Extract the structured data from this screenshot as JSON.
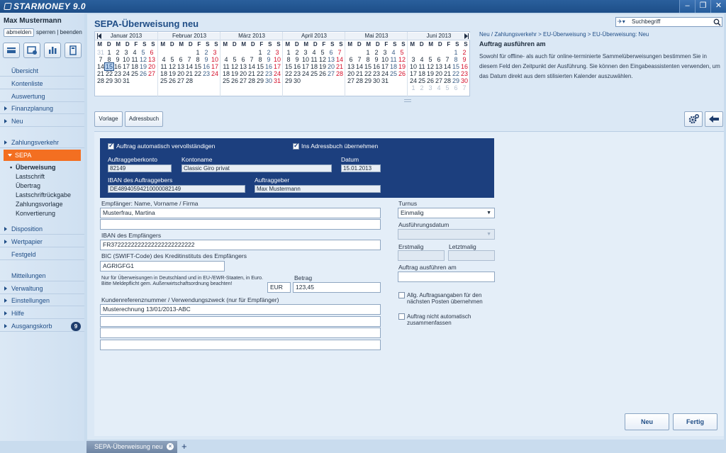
{
  "app": {
    "name": "STARMONEY 9.0",
    "window_buttons": [
      "–",
      "❐",
      "✕"
    ]
  },
  "sidebar": {
    "user": "Max Mustermann",
    "logout": "abmelden",
    "lock_logout": "sperren | beenden",
    "items": [
      {
        "label": "Übersicht"
      },
      {
        "label": "Kontenliste"
      },
      {
        "label": "Auswertung"
      },
      {
        "label": "Finanzplanung"
      },
      {
        "label": "Neu"
      },
      {
        "label": "Zahlungsverkehr"
      },
      {
        "label": "SEPA"
      },
      {
        "label": "Disposition"
      },
      {
        "label": "Wertpapier"
      },
      {
        "label": "Festgeld"
      },
      {
        "label": "Mitteilungen"
      },
      {
        "label": "Verwaltung"
      },
      {
        "label": "Einstellungen"
      },
      {
        "label": "Hilfe"
      },
      {
        "label": "Ausgangskorb"
      }
    ],
    "sepa_sub": [
      "Überweisung",
      "Lastschrift",
      "Übertrag",
      "Lastschriftrückgabe",
      "Zahlungsvorlage",
      "Konvertierung"
    ],
    "outbox_count": "9"
  },
  "header": {
    "title": "SEPA-Überweisung neu",
    "search_placeholder": "Suchbegriff"
  },
  "calendar": {
    "weekdays": [
      "M",
      "D",
      "M",
      "D",
      "F",
      "S",
      "S"
    ],
    "months": [
      {
        "name": "Januar 2013",
        "weeks": [
          [
            "31",
            "1",
            "2",
            "3",
            "4",
            "5",
            "6"
          ],
          [
            "7",
            "8",
            "9",
            "10",
            "11",
            "12",
            "13"
          ],
          [
            "14",
            "15",
            "16",
            "17",
            "18",
            "19",
            "20"
          ],
          [
            "21",
            "22",
            "23",
            "24",
            "25",
            "26",
            "27"
          ],
          [
            "28",
            "29",
            "30",
            "31",
            "",
            "",
            ""
          ]
        ]
      },
      {
        "name": "Februar 2013",
        "weeks": [
          [
            "",
            "",
            "",
            "",
            "1",
            "2",
            "3"
          ],
          [
            "4",
            "5",
            "6",
            "7",
            "8",
            "9",
            "10"
          ],
          [
            "11",
            "12",
            "13",
            "14",
            "15",
            "16",
            "17"
          ],
          [
            "18",
            "19",
            "20",
            "21",
            "22",
            "23",
            "24"
          ],
          [
            "25",
            "26",
            "27",
            "28",
            "",
            "",
            ""
          ]
        ]
      },
      {
        "name": "März 2013",
        "weeks": [
          [
            "",
            "",
            "",
            "",
            "1",
            "2",
            "3"
          ],
          [
            "4",
            "5",
            "6",
            "7",
            "8",
            "9",
            "10"
          ],
          [
            "11",
            "12",
            "13",
            "14",
            "15",
            "16",
            "17"
          ],
          [
            "18",
            "19",
            "20",
            "21",
            "22",
            "23",
            "24"
          ],
          [
            "25",
            "26",
            "27",
            "28",
            "29",
            "30",
            "31"
          ]
        ]
      },
      {
        "name": "April 2013",
        "weeks": [
          [
            "1",
            "2",
            "3",
            "4",
            "5",
            "6",
            "7"
          ],
          [
            "8",
            "9",
            "10",
            "11",
            "12",
            "13",
            "14"
          ],
          [
            "15",
            "16",
            "17",
            "18",
            "19",
            "20",
            "21"
          ],
          [
            "22",
            "23",
            "24",
            "25",
            "26",
            "27",
            "28"
          ],
          [
            "29",
            "30",
            "",
            "",
            "",
            "",
            ""
          ]
        ]
      },
      {
        "name": "Mai 2013",
        "weeks": [
          [
            "",
            "",
            "1",
            "2",
            "3",
            "4",
            "5"
          ],
          [
            "6",
            "7",
            "8",
            "9",
            "10",
            "11",
            "12"
          ],
          [
            "13",
            "14",
            "15",
            "16",
            "17",
            "18",
            "19"
          ],
          [
            "20",
            "21",
            "22",
            "23",
            "24",
            "25",
            "26"
          ],
          [
            "27",
            "28",
            "29",
            "30",
            "31",
            "",
            ""
          ]
        ]
      },
      {
        "name": "Juni 2013",
        "weeks": [
          [
            "",
            "",
            "",
            "",
            "",
            "1",
            "2"
          ],
          [
            "3",
            "4",
            "5",
            "6",
            "7",
            "8",
            "9"
          ],
          [
            "10",
            "11",
            "12",
            "13",
            "14",
            "15",
            "16"
          ],
          [
            "17",
            "18",
            "19",
            "20",
            "21",
            "22",
            "23"
          ],
          [
            "24",
            "25",
            "26",
            "27",
            "28",
            "29",
            "30"
          ],
          [
            "1",
            "2",
            "3",
            "4",
            "5",
            "6",
            "7"
          ]
        ]
      }
    ],
    "today": "15"
  },
  "help": {
    "breadcrumb": "Neu / Zahlungsverkehr > EU-Überweisung > EU-Überweisung: Neu",
    "title": "Auftrag ausführen am",
    "text": "Sowohl für offline- als auch für online-terminierte Sammelüberweisungen bestimmen Sie in diesem Feld den Zeitpunkt der Ausführung. Sie können den Eingabeassistenten verwenden, um das Datum direkt aus dem stilisierten Kalender auszuwählen."
  },
  "toolbar": {
    "vorlage": "Vorlage",
    "adressbuch": "Adressbuch"
  },
  "panel": {
    "auto_complete": "Auftrag automatisch vervollständigen",
    "add_addressbook": "Ins Adressbuch übernehmen",
    "account_label": "Auftraggeberkonto",
    "account": "82149",
    "accname_label": "Kontoname",
    "accname": "Classic Giro privat",
    "date_label": "Datum",
    "date": "15.01.2013",
    "iban_label": "IBAN des Auftraggebers",
    "iban": "DE48940594210000082149",
    "sender_label": "Auftraggeber",
    "sender": "Max Mustermann"
  },
  "form": {
    "recipient_label": "Empfänger: Name, Vorname / Firma",
    "recipient": "Musterfrau, Martina",
    "iban_label": "IBAN des Empfängers",
    "iban": "FR3722222222222222222222222",
    "bic_label": "BIC (SWIFT-Code) des Kreditinstituts des Empfängers",
    "bic": "AGRIGFG1",
    "notice": "Nur für Überweisungen in Deutschland und in EU-/EWR-Staaten, in Euro. Bitte Meldepflicht gem. Außenwirtschaftsordnung beachten!",
    "currency": "EUR",
    "amount_label": "Betrag",
    "amount": "123,45",
    "purpose_label": "Kundenreferenznummer / Verwendungszweck (nur für Empfänger)",
    "purpose": "Musterechnung 13/01/2013-ABC",
    "turnus_label": "Turnus",
    "turnus": "Einmalig",
    "exec_date_label": "Ausführungsdatum",
    "first_label": "Erstmalig",
    "last_label": "Letztmalig",
    "exec_on_label": "Auftrag ausführen am",
    "opt1": "Allg. Auftragsangaben für den nächsten Posten übernehmen",
    "opt2": "Auftrag nicht automatisch zusammenfassen"
  },
  "buttons": {
    "neu": "Neu",
    "fertig": "Fertig"
  },
  "tabs": [
    {
      "label": "SEPA-Überweisung neu"
    }
  ],
  "icons": [
    "settings-gear-icon",
    "back-arrow-icon",
    "search-icon",
    "star-filter-icon"
  ]
}
